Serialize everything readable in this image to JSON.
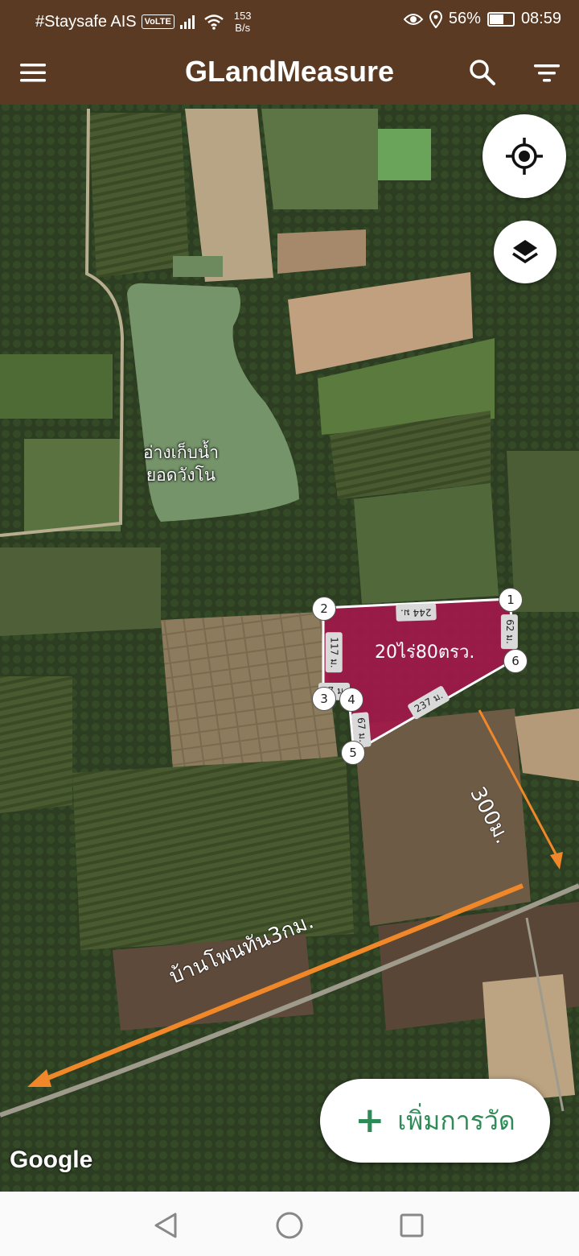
{
  "status_bar": {
    "carrier": "#Staysafe AIS",
    "volte": "VoLTE",
    "speed_value": "153",
    "speed_unit": "B/s",
    "battery": "56%",
    "time": "08:59"
  },
  "app_bar": {
    "title": "GLandMeasure",
    "menu_icon": "hamburger-menu-icon",
    "search_icon": "search-icon",
    "filter_icon": "filter-icon"
  },
  "map": {
    "location_icon": "my-location-icon",
    "layers_icon": "layers-icon",
    "reservoir_label_line1": "อ่างเก็บน้ำ",
    "reservoir_label_line2": "ยอดวังโน",
    "plot": {
      "area_label": "20ไร่80ตรว.",
      "fill_color": "#a3174a",
      "points": [
        "1",
        "2",
        "3",
        "4",
        "5",
        "6"
      ],
      "edges": {
        "top": "244 ม.",
        "left": "117 ม.",
        "left_short": "37 ม.",
        "bottom_left": "67 ม.",
        "bottom_right": "237 ม.",
        "right": "62 ม."
      }
    },
    "annotation_distance": "300ม.",
    "annotation_village": "บ้านโพนทัน3กม.",
    "arrow_color": "#f0882a",
    "attribution": "Google"
  },
  "add_button": {
    "plus": "+",
    "label": "เพิ่มการวัด",
    "color": "#2e8b57"
  },
  "nav_bar": {
    "back_icon": "back-triangle-icon",
    "home_icon": "home-circle-icon",
    "recents_icon": "recents-square-icon"
  }
}
